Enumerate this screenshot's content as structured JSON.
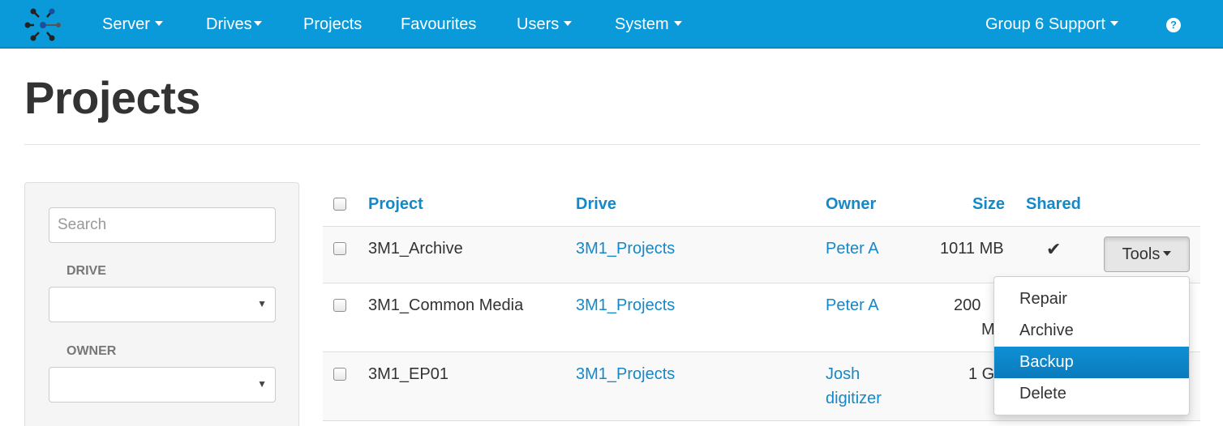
{
  "navbar": {
    "items": [
      {
        "label": "Server",
        "has_caret": true
      },
      {
        "label": "Drives",
        "has_caret": true
      },
      {
        "label": "Projects",
        "has_caret": false
      },
      {
        "label": "Favourites",
        "has_caret": false
      },
      {
        "label": "Users",
        "has_caret": true
      },
      {
        "label": "System",
        "has_caret": true
      }
    ],
    "account_label": "Group 6 Support",
    "help_icon": "question-circle-icon",
    "help_glyph": "?",
    "logo_icon": "network-logo-icon",
    "colors": {
      "bar": "#0a9ad9",
      "text": "#ffffff"
    }
  },
  "page": {
    "title": "Projects"
  },
  "filters": {
    "search_placeholder": "Search",
    "search_value": "",
    "drive_label": "DRIVE",
    "drive_value": "",
    "owner_label": "OWNER",
    "owner_value": "",
    "select_arrow": "▼"
  },
  "table": {
    "headers": {
      "project": "Project",
      "drive": "Drive",
      "owner": "Owner",
      "size": "Size",
      "shared": "Shared"
    },
    "rows": [
      {
        "project": "3M1_Archive",
        "drive": "3M1_Projects",
        "owner": "Peter A",
        "size": "1011 MB",
        "shared": "✔",
        "tools_label": "Tools"
      },
      {
        "project": "3M1_Common Media",
        "drive": "3M1_Projects",
        "owner": "Peter A",
        "size_line1": "200",
        "size_line2": "M"
      },
      {
        "project": "3M1_EP01",
        "drive": "3M1_Projects",
        "owner_line1": "Josh",
        "owner_line2": "digitizer",
        "size": "1 G"
      }
    ],
    "link_color": "#1588c8"
  },
  "tools_menu": {
    "items": [
      "Repair",
      "Archive",
      "Backup",
      "Delete"
    ],
    "active_item": "Backup",
    "active_color": "#0a7bbd"
  }
}
